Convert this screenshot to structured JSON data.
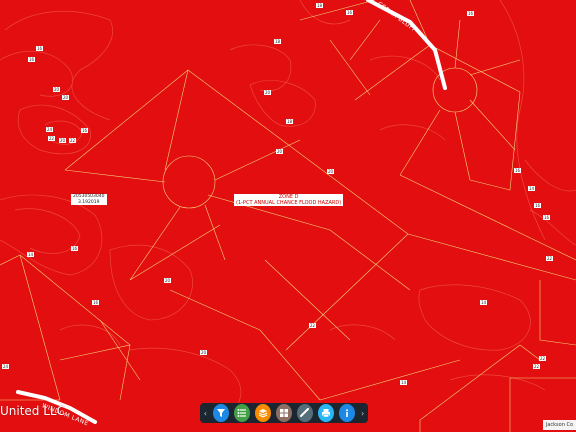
{
  "map": {
    "zone_label": [
      "ZONE D",
      "(1-PCT ANNUAL CHANCE FLOOD HAZARD)"
    ],
    "parcel_label": [
      "20530503040",
      "3.192019"
    ],
    "streets": [
      "CEDAR BLUFF",
      "WINDOM LANE"
    ],
    "attribution": "United LLC",
    "credit": "Jackson Co",
    "contour_labels": [
      "18",
      "16",
      "16",
      "18",
      "16",
      "16",
      "20",
      "20",
      "20",
      "24",
      "22",
      "20",
      "22",
      "16",
      "18",
      "20",
      "20",
      "16",
      "14",
      "16",
      "16",
      "16",
      "14",
      "22",
      "20",
      "22",
      "22",
      "22",
      "24",
      "14",
      "16",
      "20",
      "14"
    ]
  },
  "toolbar": {
    "prev_label": "‹",
    "next_label": "›",
    "buttons": [
      {
        "name": "filter",
        "color": "#1e88e5"
      },
      {
        "name": "list",
        "color": "#43a047"
      },
      {
        "name": "layers",
        "color": "#fb8c00"
      },
      {
        "name": "grid",
        "color": "#8d6e63"
      },
      {
        "name": "measure",
        "color": "#546e7a"
      },
      {
        "name": "print",
        "color": "#29b6f6"
      },
      {
        "name": "info",
        "color": "#1e88e5"
      }
    ]
  }
}
